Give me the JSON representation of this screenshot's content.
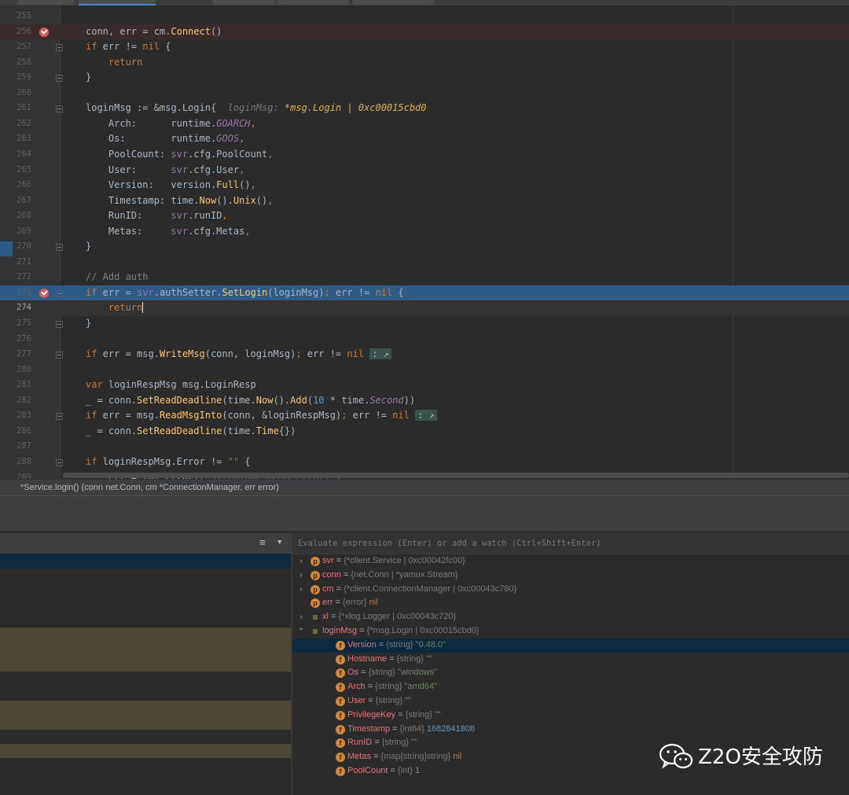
{
  "editor": {
    "lines": [
      {
        "n": "255",
        "parts": []
      },
      {
        "n": "256",
        "bp": true,
        "fold": false,
        "cls": "bpline",
        "parts": [
          [
            "",
            "conn, err = cm."
          ],
          [
            "call",
            "Connect"
          ],
          [
            "",
            "()"
          ]
        ]
      },
      {
        "n": "257",
        "fold": true,
        "parts": [
          [
            "kw",
            "if"
          ],
          [
            "",
            " err != "
          ],
          [
            "kw",
            "nil"
          ],
          [
            "",
            " {"
          ]
        ]
      },
      {
        "n": "258",
        "parts": [
          [
            "",
            "    "
          ],
          [
            "kw",
            "return"
          ]
        ]
      },
      {
        "n": "259",
        "fold": true,
        "parts": [
          [
            "",
            "}"
          ]
        ]
      },
      {
        "n": "260",
        "parts": []
      },
      {
        "n": "261",
        "fold": true,
        "parts": [
          [
            "",
            "loginMsg := &msg."
          ],
          [
            "ty",
            "Login"
          ],
          [
            "",
            "{  "
          ],
          [
            "hint",
            "loginMsg: "
          ],
          [
            "hintv",
            "*msg.Login | 0xc00015cbd0"
          ]
        ]
      },
      {
        "n": "262",
        "parts": [
          [
            "",
            "    Arch:      runtime."
          ],
          [
            "it",
            "GOARCH"
          ],
          [
            "kw",
            ","
          ]
        ]
      },
      {
        "n": "263",
        "parts": [
          [
            "",
            "    Os:        runtime."
          ],
          [
            "it",
            "GOOS"
          ],
          [
            "kw",
            ","
          ]
        ]
      },
      {
        "n": "264",
        "parts": [
          [
            "",
            "    PoolCount: "
          ],
          [
            "vr",
            "svr"
          ],
          [
            "",
            ".cfg.PoolCount"
          ],
          [
            "kw",
            ","
          ]
        ]
      },
      {
        "n": "265",
        "parts": [
          [
            "",
            "    User:      "
          ],
          [
            "vr",
            "svr"
          ],
          [
            "",
            ".cfg.User"
          ],
          [
            "kw",
            ","
          ]
        ]
      },
      {
        "n": "266",
        "parts": [
          [
            "",
            "    Version:   version."
          ],
          [
            "call",
            "Full"
          ],
          [
            "",
            "()"
          ],
          [
            "kw",
            ","
          ]
        ]
      },
      {
        "n": "267",
        "parts": [
          [
            "",
            "    Timestamp: time."
          ],
          [
            "call",
            "Now"
          ],
          [
            "",
            "()."
          ],
          [
            "call",
            "Unix"
          ],
          [
            "",
            "()"
          ],
          [
            "kw",
            ","
          ]
        ]
      },
      {
        "n": "268",
        "parts": [
          [
            "",
            "    RunID:     "
          ],
          [
            "vr",
            "svr"
          ],
          [
            "",
            ".runID"
          ],
          [
            "kw",
            ","
          ]
        ]
      },
      {
        "n": "269",
        "parts": [
          [
            "",
            "    Metas:     "
          ],
          [
            "vr",
            "svr"
          ],
          [
            "",
            ".cfg.Metas"
          ],
          [
            "kw",
            ","
          ]
        ]
      },
      {
        "n": "270",
        "fold": true,
        "parts": [
          [
            "",
            "}"
          ]
        ]
      },
      {
        "n": "271",
        "parts": []
      },
      {
        "n": "272",
        "parts": [
          [
            "cm",
            "// Add auth"
          ]
        ]
      },
      {
        "n": "273",
        "bp": true,
        "fold": true,
        "cls": "exec",
        "parts": [
          [
            "kw",
            "if"
          ],
          [
            "",
            " err = "
          ],
          [
            "sel-svr",
            "svr"
          ],
          [
            "",
            ".authSetter."
          ],
          [
            "call",
            "SetLogin"
          ],
          [
            "",
            "(loginMsg)"
          ],
          [
            "kw",
            ";"
          ],
          [
            "",
            " err != "
          ],
          [
            "kw",
            "nil"
          ],
          [
            "",
            " {"
          ]
        ]
      },
      {
        "n": "274",
        "cur": true,
        "cls": "curline",
        "parts": [
          [
            "",
            "    "
          ],
          [
            "kw caret",
            "return"
          ]
        ]
      },
      {
        "n": "275",
        "fold": true,
        "parts": [
          [
            "",
            "}"
          ]
        ]
      },
      {
        "n": "276",
        "parts": []
      },
      {
        "n": "277",
        "fold": true,
        "parts": [
          [
            "kw",
            "if"
          ],
          [
            "",
            " err = msg."
          ],
          [
            "call",
            "WriteMsg"
          ],
          [
            "",
            "(conn, loginMsg)"
          ],
          [
            "kw",
            ";"
          ],
          [
            "",
            " err != "
          ],
          [
            "kw",
            "nil"
          ],
          [
            "",
            " "
          ],
          [
            "foldbox",
            ": ↗"
          ]
        ]
      },
      {
        "n": "280",
        "parts": []
      },
      {
        "n": "281",
        "parts": [
          [
            "kw",
            "var"
          ],
          [
            "",
            " loginRespMsg msg."
          ],
          [
            "ty",
            "LoginResp"
          ]
        ]
      },
      {
        "n": "282",
        "parts": [
          [
            "",
            "_ = conn."
          ],
          [
            "call",
            "SetReadDeadline"
          ],
          [
            "",
            "(time."
          ],
          [
            "call",
            "Now"
          ],
          [
            "",
            "()."
          ],
          [
            "call",
            "Add"
          ],
          [
            "",
            "("
          ],
          [
            "num",
            "10"
          ],
          [
            "",
            " * time."
          ],
          [
            "it",
            "Second"
          ],
          [
            "",
            "))"
          ]
        ]
      },
      {
        "n": "283",
        "fold": true,
        "parts": [
          [
            "kw",
            "if"
          ],
          [
            "",
            " err = msg."
          ],
          [
            "call",
            "ReadMsgInto"
          ],
          [
            "",
            "(conn, &loginRespMsg)"
          ],
          [
            "kw",
            ";"
          ],
          [
            "",
            " err != "
          ],
          [
            "kw",
            "nil"
          ],
          [
            "",
            " "
          ],
          [
            "foldbox",
            ": ↗"
          ]
        ]
      },
      {
        "n": "286",
        "parts": [
          [
            "",
            "_ = conn."
          ],
          [
            "call",
            "SetReadDeadline"
          ],
          [
            "",
            "(time."
          ],
          [
            "call",
            "Time"
          ],
          [
            "",
            "{})"
          ]
        ]
      },
      {
        "n": "287",
        "parts": []
      },
      {
        "n": "288",
        "fold": true,
        "parts": [
          [
            "kw",
            "if"
          ],
          [
            "",
            " loginRespMsg.Error != "
          ],
          [
            "str",
            "\"\""
          ],
          [
            "",
            " {"
          ]
        ]
      },
      {
        "n": "289",
        "parts": [
          [
            "",
            "    err = fmt."
          ],
          [
            "call",
            "Errorf"
          ],
          [
            "",
            "("
          ],
          [
            "str",
            "\"%{loginRespMsg.Error}\""
          ],
          [
            "",
            ")"
          ]
        ]
      }
    ]
  },
  "breadcrumb": "*Service.login() (conn net.Conn, cm *ConnectionManager, err error)",
  "evaluate": {
    "placeholder": "Evaluate expression (Enter) or add a watch (Ctrl+Shift+Enter)"
  },
  "variables": [
    {
      "arrow": "›",
      "icon": "p",
      "name": "svr",
      "type": "{*client.Service | 0xc00042fc00}",
      "val": "",
      "vcls": "vval",
      "indent": 0
    },
    {
      "arrow": "›",
      "icon": "p",
      "name": "conn",
      "type": "{net.Conn | *yamux.Stream}",
      "val": "",
      "vcls": "vval",
      "indent": 0
    },
    {
      "arrow": "›",
      "icon": "p",
      "name": "cm",
      "type": "{*client.ConnectionManager | 0xc00043c780}",
      "val": "",
      "vcls": "vval",
      "indent": 0
    },
    {
      "arrow": "",
      "icon": "p",
      "name": "err",
      "type": "{error}",
      "val": "nil",
      "vcls": "vkw",
      "indent": 0
    },
    {
      "arrow": "›",
      "icon": "l",
      "name": "xl",
      "type": "{*xlog.Logger | 0xc00043c720}",
      "val": "",
      "vcls": "vval",
      "indent": 0
    },
    {
      "arrow": "⌄",
      "icon": "l",
      "name": "loginMsg",
      "type": "{*msg.Login | 0xc00015cbd0}",
      "val": "",
      "vcls": "vval",
      "indent": 0
    },
    {
      "arrow": "",
      "icon": "f",
      "name": "Version",
      "type": "{string}",
      "val": "\"0.48.0\"",
      "vcls": "vstr",
      "indent": 1,
      "sel": true
    },
    {
      "arrow": "",
      "icon": "f",
      "name": "Hostname",
      "type": "{string}",
      "val": "\"\"",
      "vcls": "vstr",
      "indent": 1
    },
    {
      "arrow": "",
      "icon": "f",
      "name": "Os",
      "type": "{string}",
      "val": "\"windows\"",
      "vcls": "vstr",
      "indent": 1
    },
    {
      "arrow": "",
      "icon": "f",
      "name": "Arch",
      "type": "{string}",
      "val": "\"amd64\"",
      "vcls": "vstr",
      "indent": 1
    },
    {
      "arrow": "",
      "icon": "f",
      "name": "User",
      "type": "{string}",
      "val": "\"\"",
      "vcls": "vstr",
      "indent": 1
    },
    {
      "arrow": "",
      "icon": "f",
      "name": "PrivilegeKey",
      "type": "{string}",
      "val": "\"\"",
      "vcls": "vstr",
      "indent": 1
    },
    {
      "arrow": "",
      "icon": "f",
      "name": "Timestamp",
      "type": "{int64}",
      "val": "1682841808",
      "vcls": "vnum",
      "indent": 1
    },
    {
      "arrow": "",
      "icon": "f",
      "name": "RunID",
      "type": "{string}",
      "val": "\"\"",
      "vcls": "vstr",
      "indent": 1
    },
    {
      "arrow": "",
      "icon": "f",
      "name": "Metas",
      "type": "{map[string]string}",
      "val": "nil",
      "vcls": "vkw",
      "indent": 1
    },
    {
      "arrow": "",
      "icon": "f",
      "name": "PoolCount",
      "type": "{int}",
      "val": "1",
      "vcls": "vnum",
      "indent": 1
    }
  ],
  "frames": {
    "rows": [
      {
        "color": "#0d293e"
      },
      {
        "color": "#2b2b2b"
      },
      {
        "color": "#2b2b2b"
      },
      {
        "color": "#4b4636"
      },
      {
        "color": "#2b2b2b"
      },
      {
        "color": "#4b4636"
      },
      {
        "color": "#2b2b2b"
      },
      {
        "color": "#4b4636"
      }
    ]
  },
  "watermark": {
    "text": "Z2O安全攻防",
    "icon": "wechat-icon"
  },
  "colors": {
    "execution_line": "#2d5a86",
    "breakpoint": "#db5c5c",
    "selected_var": "#0d293e"
  }
}
